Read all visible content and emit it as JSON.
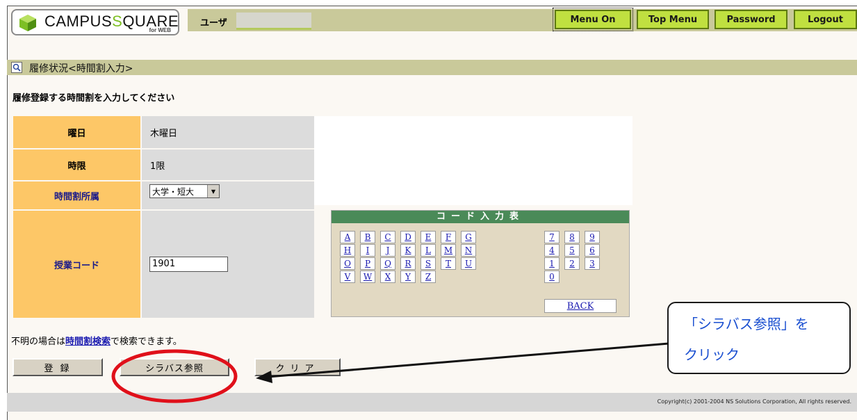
{
  "header": {
    "logo_text_a": "CAMPUS",
    "logo_text_s": "S",
    "logo_text_b": "QUARE",
    "logo_sub": "for WEB",
    "user_label": "ユーザ",
    "menu": {
      "menu_on": "Menu On",
      "top_menu": "Top Menu",
      "password": "Password",
      "logout": "Logout"
    }
  },
  "page": {
    "title": "履修状況<時間割入力>",
    "instruction": "履修登録する時間割を入力してください"
  },
  "form": {
    "day_label": "曜日",
    "day_value": "木曜日",
    "period_label": "時限",
    "period_value": "1限",
    "affiliation_label": "時間割所属",
    "affiliation_selected": "大学・短大",
    "course_code_label": "授業コード",
    "course_code_value": "1901"
  },
  "code_table": {
    "header": "コード入力表",
    "letters": [
      [
        "A",
        "B",
        "C",
        "D",
        "E",
        "F",
        "G"
      ],
      [
        "H",
        "I",
        "J",
        "K",
        "L",
        "M",
        "N"
      ],
      [
        "O",
        "P",
        "Q",
        "R",
        "S",
        "T",
        "U"
      ],
      [
        "V",
        "W",
        "X",
        "Y",
        "Z"
      ]
    ],
    "digits": [
      [
        "7",
        "8",
        "9"
      ],
      [
        "4",
        "5",
        "6"
      ],
      [
        "1",
        "2",
        "3"
      ],
      [
        "0"
      ]
    ],
    "back": "BACK"
  },
  "help": {
    "prefix": "不明の場合は",
    "link": "時間割検索",
    "suffix": "で検索できます。"
  },
  "buttons": {
    "register": "登 録",
    "syllabus": "シラバス参照",
    "clear": "クリア"
  },
  "footer": {
    "copyright": "Copyright(c) 2001-2004 NS Solutions Corporation, All rights reserved."
  },
  "annotation": {
    "line1": "「シラバス参照」を",
    "line2": "クリック"
  },
  "colors": {
    "accent": "#c0e040",
    "label_bg": "#fdc767",
    "code_header": "#4a8a58",
    "annotation_red": "#e0101a"
  }
}
